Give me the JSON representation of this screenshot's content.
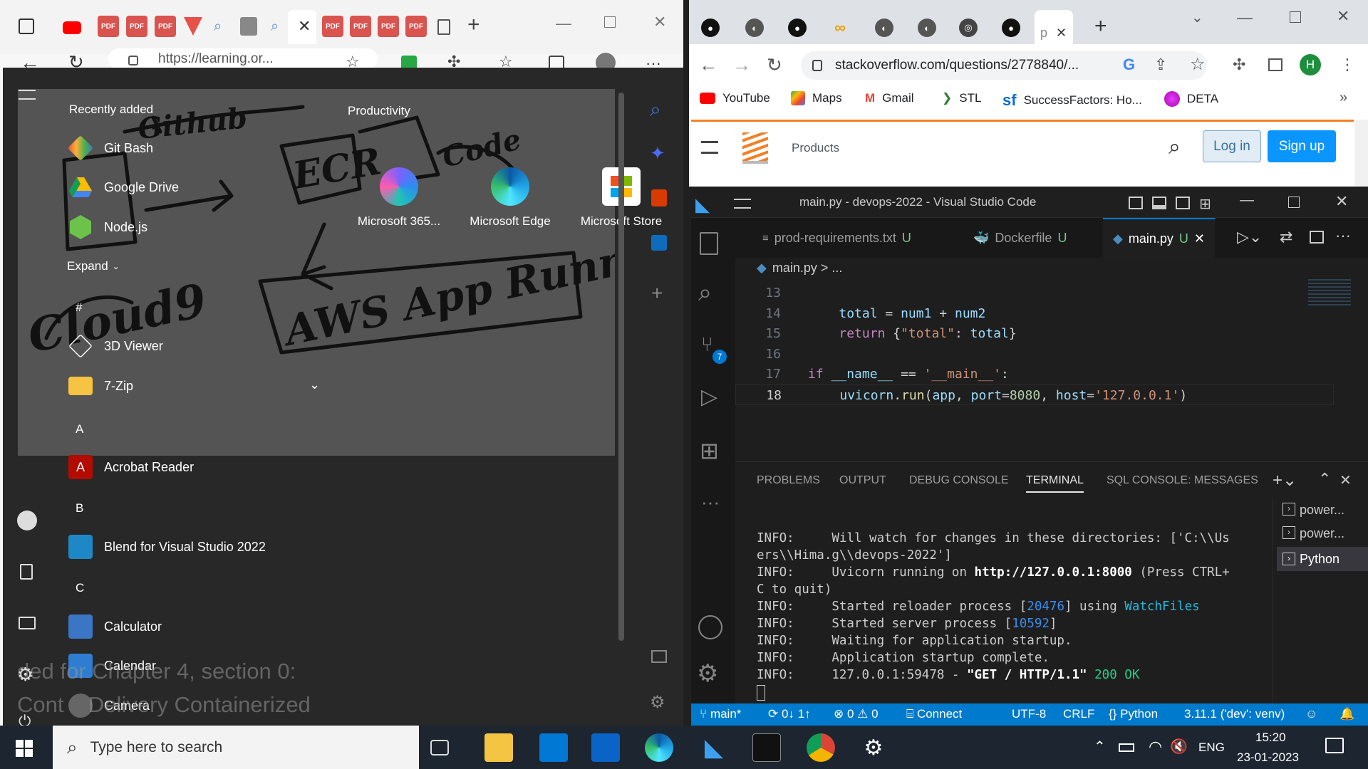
{
  "edge": {
    "url": "https://learning.or...",
    "tab_labels": [
      "PDF",
      "PDF",
      "PDF",
      "PDF",
      "PDF",
      "PDF",
      "PDF"
    ]
  },
  "start_menu": {
    "recently_added_label": "Recently added",
    "productivity_label": "Productivity",
    "recent_apps": [
      "Git Bash",
      "Google Drive",
      "Node.js"
    ],
    "expand_label": "Expand",
    "pinned": [
      "Microsoft 365...",
      "Microsoft Edge",
      "Microsoft Store"
    ],
    "sections": [
      {
        "letter": "#",
        "apps": [
          "3D Viewer",
          "7-Zip"
        ]
      },
      {
        "letter": "A",
        "apps": [
          "Acrobat Reader"
        ]
      },
      {
        "letter": "B",
        "apps": [
          "Blend for Visual Studio 2022"
        ]
      },
      {
        "letter": "C",
        "apps": [
          "Calculator",
          "Calendar",
          "Camera"
        ]
      }
    ],
    "handwriting": [
      "Github",
      "ECR",
      "Code",
      "Cloud9",
      "AWS App Runner"
    ],
    "background_text_1": "ded for Chapter 4, section 0:",
    "background_text_2": "Cont    Delivery Containerized"
  },
  "chrome": {
    "url": "stackoverflow.com/questions/2778840/...",
    "active_tab_label": "p",
    "bookmarks": [
      "YouTube",
      "Maps",
      "Gmail",
      "STL",
      "SuccessFactors: Ho...",
      "DETA"
    ],
    "products_label": "Products",
    "login_label": "Log in",
    "signup_label": "Sign up",
    "profile_initial": "H"
  },
  "vscode": {
    "title": "main.py - devops-2022 - Visual Studio Code",
    "tabs": [
      {
        "name": "prod-requirements.txt",
        "status": "U"
      },
      {
        "name": "Dockerfile",
        "status": "U"
      },
      {
        "name": "main.py",
        "status": "U"
      }
    ],
    "breadcrumb": "main.py > ...",
    "scm_badge": "7",
    "code_lines": [
      {
        "n": "13",
        "text": ""
      },
      {
        "n": "14",
        "text": "    total = num1 + num2"
      },
      {
        "n": "15",
        "text": "    return {\"total\": total}"
      },
      {
        "n": "16",
        "text": ""
      },
      {
        "n": "17",
        "text": "if __name__ == '__main__':"
      },
      {
        "n": "18",
        "text": "    uvicorn.run(app, port=8080, host='127.0.0.1')"
      }
    ],
    "panel_tabs": [
      "PROBLEMS",
      "OUTPUT",
      "DEBUG CONSOLE",
      "TERMINAL",
      "SQL CONSOLE: MESSAGES"
    ],
    "terminal_lines": [
      "INFO:     Will watch for changes in these directories: ['C:\\\\Us",
      "ers\\\\Hima.g\\\\devops-2022']",
      "INFO:     Uvicorn running on http://127.0.0.1:8000 (Press CTRL+",
      "C to quit)",
      "INFO:     Started reloader process [20476] using WatchFiles",
      "INFO:     Started server process [10592]",
      "INFO:     Waiting for application startup.",
      "INFO:     Application startup complete.",
      "INFO:     127.0.0.1:59478 - \"GET / HTTP/1.1\" 200 OK"
    ],
    "terminal_list": [
      "power...",
      "power...",
      "Python"
    ],
    "status": {
      "branch": "main*",
      "sync": "0↓ 1↑",
      "problems": "0",
      "warnings": "0",
      "connect": "Connect",
      "encoding": "UTF-8",
      "eol": "CRLF",
      "language": "Python",
      "interpreter": "3.11.1 ('dev': venv)"
    }
  },
  "taskbar": {
    "search_placeholder": "Type here to search",
    "language": "ENG",
    "time": "15:20",
    "date": "23-01-2023"
  }
}
